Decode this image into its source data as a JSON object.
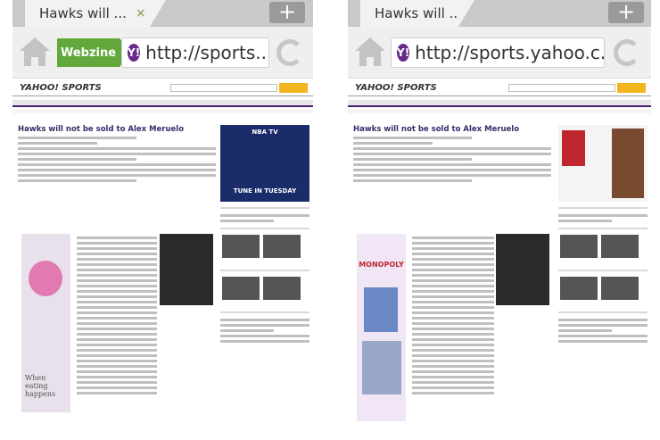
{
  "left": {
    "tab_title": "Hawks will ...",
    "close_glyph": "×",
    "newtab_glyph": "+",
    "webzine_label": "Webzine",
    "url": "http://sports....",
    "y_glyph": "Y!"
  },
  "right": {
    "tab_title": "Hawks will ...",
    "newtab_glyph": "+",
    "url": "http://sports.yahoo.c...",
    "y_glyph": "Y!"
  },
  "page": {
    "logo": "YAHOO! SPORTS",
    "headline": "Hawks will not be sold to Alex Meruelo",
    "ad_tagline": "TUNE IN TUESDAY",
    "ad_brand": "NBA TV",
    "left_ad_text": "When eating happens",
    "right_ad_text": "MONOPOLY"
  },
  "colors": {
    "accent_green": "#62a83c",
    "yahoo_purple": "#6a2a8c"
  }
}
